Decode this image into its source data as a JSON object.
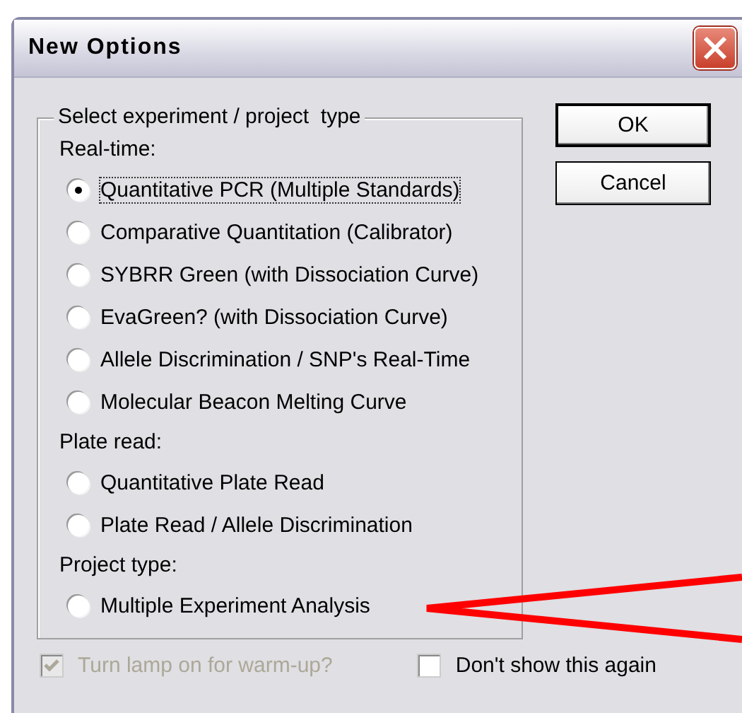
{
  "window": {
    "title": "New Options"
  },
  "group": {
    "legend": "Select experiment / project  type",
    "items": [
      {
        "kind": "heading",
        "label": "Real-time:"
      },
      {
        "kind": "radio",
        "label": "Quantitative PCR (Multiple Standards)",
        "selected": true
      },
      {
        "kind": "radio",
        "label": "Comparative Quantitation (Calibrator)",
        "selected": false
      },
      {
        "kind": "radio",
        "label": "SYBRR Green (with Dissociation Curve)",
        "selected": false
      },
      {
        "kind": "radio",
        "label": "EvaGreen? (with Dissociation Curve)",
        "selected": false
      },
      {
        "kind": "radio",
        "label": "Allele Discrimination / SNP's Real-Time",
        "selected": false
      },
      {
        "kind": "radio",
        "label": "Molecular Beacon Melting Curve",
        "selected": false
      },
      {
        "kind": "heading",
        "label": "Plate read:"
      },
      {
        "kind": "radio",
        "label": "Quantitative Plate Read",
        "selected": false
      },
      {
        "kind": "radio",
        "label": "Plate Read / Allele Discrimination",
        "selected": false
      },
      {
        "kind": "heading",
        "label": "Project type:"
      },
      {
        "kind": "radio",
        "label": "Multiple Experiment Analysis",
        "selected": false
      }
    ]
  },
  "buttons": [
    "OK",
    "Cancel"
  ],
  "checkboxes": [
    {
      "label": "Turn lamp on for warm-up?",
      "checked": true,
      "disabled": true
    },
    {
      "label": "Don't show this again",
      "checked": false,
      "disabled": false
    }
  ]
}
